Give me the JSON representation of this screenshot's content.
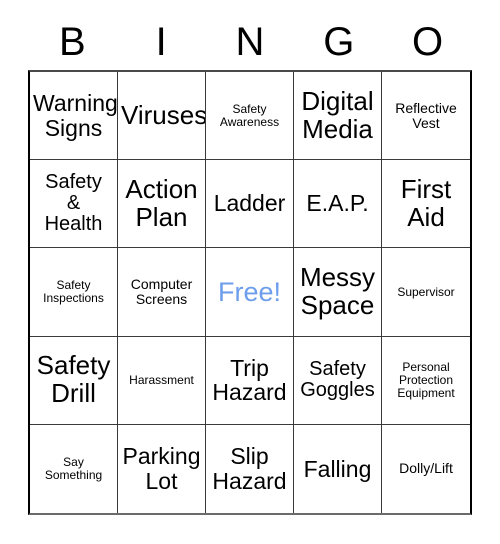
{
  "card": {
    "header_letters": [
      "B",
      "I",
      "N",
      "G",
      "O"
    ],
    "free_color": "#6d9eeb",
    "grid_line_color": "#3a3a3a",
    "rows": [
      [
        {
          "label": "Warning\nSigns",
          "size": "lg"
        },
        {
          "label": "Viruses",
          "size": "xl"
        },
        {
          "label": "Safety\nAwareness",
          "size": "xs"
        },
        {
          "label": "Digital\nMedia",
          "size": "xl"
        },
        {
          "label": "Reflective\nVest",
          "size": "sm"
        }
      ],
      [
        {
          "label": "Safety\n&\nHealth",
          "size": "md"
        },
        {
          "label": "Action\nPlan",
          "size": "xl"
        },
        {
          "label": "Ladder",
          "size": "lg"
        },
        {
          "label": "E.A.P.",
          "size": "lg"
        },
        {
          "label": "First\nAid",
          "size": "xl"
        }
      ],
      [
        {
          "label": "Safety\nInspections",
          "size": "xs"
        },
        {
          "label": "Computer\nScreens",
          "size": "sm"
        },
        {
          "label": "Free!",
          "size": "free"
        },
        {
          "label": "Messy\nSpace",
          "size": "xl"
        },
        {
          "label": "Supervisor",
          "size": "xs"
        }
      ],
      [
        {
          "label": "Safety\nDrill",
          "size": "xl"
        },
        {
          "label": "Harassment",
          "size": "xs"
        },
        {
          "label": "Trip\nHazard",
          "size": "lg"
        },
        {
          "label": "Safety\nGoggles",
          "size": "md"
        },
        {
          "label": "Personal\nProtection\nEquipment",
          "size": "xs"
        }
      ],
      [
        {
          "label": "Say\nSomething",
          "size": "xs"
        },
        {
          "label": "Parking\nLot",
          "size": "lg"
        },
        {
          "label": "Slip\nHazard",
          "size": "lg"
        },
        {
          "label": "Falling",
          "size": "lg"
        },
        {
          "label": "Dolly/Lift",
          "size": "sm"
        }
      ]
    ]
  }
}
